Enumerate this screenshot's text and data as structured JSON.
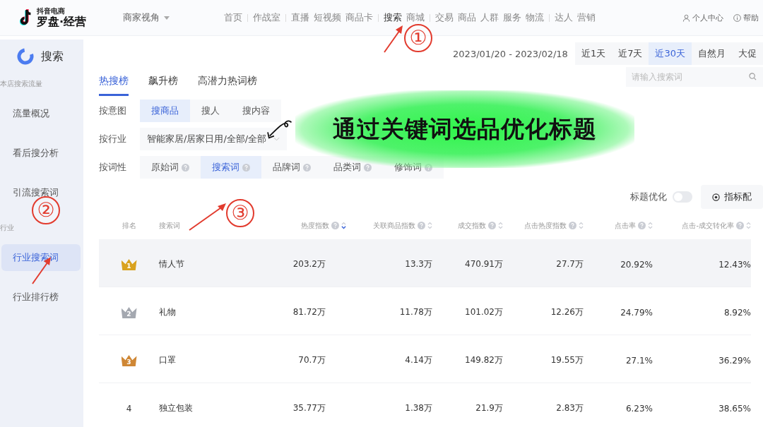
{
  "brand": {
    "small": "抖音电商",
    "name": "罗盘·经营"
  },
  "perspective": {
    "label": "商家视角"
  },
  "nav_groups": [
    [
      {
        "label": "首页",
        "selected": false
      }
    ],
    [
      {
        "label": "作战室",
        "selected": false
      }
    ],
    [
      {
        "label": "直播",
        "selected": false
      },
      {
        "label": "短视频",
        "selected": false
      },
      {
        "label": "商品卡",
        "selected": false
      }
    ],
    [
      {
        "label": "搜索",
        "selected": true
      },
      {
        "label": "商城",
        "selected": false
      }
    ],
    [
      {
        "label": "交易",
        "selected": false
      },
      {
        "label": "商品",
        "selected": false
      },
      {
        "label": "人群",
        "selected": false
      },
      {
        "label": "服务",
        "selected": false
      },
      {
        "label": "物流",
        "selected": false
      }
    ],
    [
      {
        "label": "达人",
        "selected": false
      },
      {
        "label": "营销",
        "selected": false
      }
    ]
  ],
  "user_links": [
    {
      "kind": "user",
      "label": "个人中心"
    },
    {
      "kind": "help",
      "label": "帮助"
    }
  ],
  "sidebar": {
    "title": "搜索",
    "groups": [
      {
        "label": "本店搜索流量",
        "items": [
          {
            "label": "流量概况",
            "selected": false
          },
          {
            "label": "看后搜分析",
            "selected": false
          },
          {
            "label": "引流搜索词",
            "selected": false
          }
        ]
      },
      {
        "label": "行业",
        "items": [
          {
            "label": "行业搜索词",
            "selected": true
          },
          {
            "label": "行业排行榜",
            "selected": false
          }
        ]
      }
    ]
  },
  "date_range": "2023/01/20 - 2023/02/18",
  "date_tabs": [
    {
      "label": "近1天",
      "selected": false
    },
    {
      "label": "近7天",
      "selected": false
    },
    {
      "label": "近30天",
      "selected": true
    },
    {
      "label": "自然月",
      "selected": false
    },
    {
      "label": "大促",
      "selected": false
    }
  ],
  "tabs": [
    {
      "label": "热搜榜",
      "selected": true
    },
    {
      "label": "飙升榜",
      "selected": false
    },
    {
      "label": "高潜力热词榜",
      "selected": false
    }
  ],
  "search": {
    "placeholder": "请输入搜索词"
  },
  "filters": [
    {
      "kind": "options",
      "label": "按意图",
      "options": [
        {
          "label": "搜商品",
          "help": false,
          "selected": true
        },
        {
          "label": "搜人",
          "help": false,
          "selected": false
        },
        {
          "label": "搜内容",
          "help": false,
          "selected": false
        }
      ]
    },
    {
      "kind": "dropdown",
      "label": "按行业",
      "value": "智能家居/居家日用/全部/全部"
    },
    {
      "kind": "options",
      "label": "按词性",
      "options": [
        {
          "label": "原始词",
          "help": true,
          "selected": false
        },
        {
          "label": "搜索词",
          "help": true,
          "selected": true
        },
        {
          "label": "品牌词",
          "help": true,
          "selected": false
        },
        {
          "label": "品类词",
          "help": true,
          "selected": false
        },
        {
          "label": "修饰词",
          "help": true,
          "selected": false
        }
      ]
    }
  ],
  "title_optimize": {
    "label": "标题优化",
    "on": false
  },
  "metric_button": {
    "label": "指标配"
  },
  "table": {
    "columns": [
      {
        "label": "排名",
        "help": false,
        "sortable": false
      },
      {
        "label": "搜索词",
        "help": false,
        "sortable": false
      },
      {
        "label": "热度指数",
        "help": true,
        "sortable": true,
        "sorted": true
      },
      {
        "label": "关联商品指数",
        "help": true,
        "sortable": true,
        "sorted": false
      },
      {
        "label": "成交指数",
        "help": true,
        "sortable": true,
        "sorted": false
      },
      {
        "label": "点击热度指数",
        "help": true,
        "sortable": true,
        "sorted": false
      },
      {
        "label": "点击率",
        "help": true,
        "sortable": true,
        "sorted": false
      },
      {
        "label": "点击-成交转化率",
        "help": true,
        "sortable": true,
        "sorted": false
      }
    ],
    "rows": [
      {
        "kind": "crown",
        "color": "#d9a21f",
        "selected": true,
        "cells": [
          "1",
          "情人节",
          "203.2万",
          "13.3万",
          "470.91万",
          "27.7万",
          "20.92%",
          "12.43%"
        ]
      },
      {
        "kind": "crown",
        "color": "#a4a8b0",
        "selected": false,
        "cells": [
          "2",
          "礼物",
          "81.72万",
          "11.78万",
          "101.02万",
          "12.26万",
          "24.79%",
          "8.92%"
        ]
      },
      {
        "kind": "crown",
        "color": "#cf8735",
        "selected": false,
        "cells": [
          "3",
          "口罩",
          "70.7万",
          "4.14万",
          "149.82万",
          "19.55万",
          "27.1%",
          "36.29%"
        ]
      },
      {
        "kind": "plain",
        "selected": false,
        "cells": [
          "4",
          "独立包装",
          "35.77万",
          "1.38万",
          "21.9万",
          "2.83万",
          "6.23%",
          "38.65%"
        ]
      }
    ]
  },
  "overlay_caption": {
    "text": "通过关键词选品优化标题"
  },
  "annotations": [
    {
      "kind": "circled_number",
      "text": "①"
    },
    {
      "kind": "circled_number",
      "text": "②"
    },
    {
      "kind": "circled_number",
      "text": "③"
    }
  ]
}
